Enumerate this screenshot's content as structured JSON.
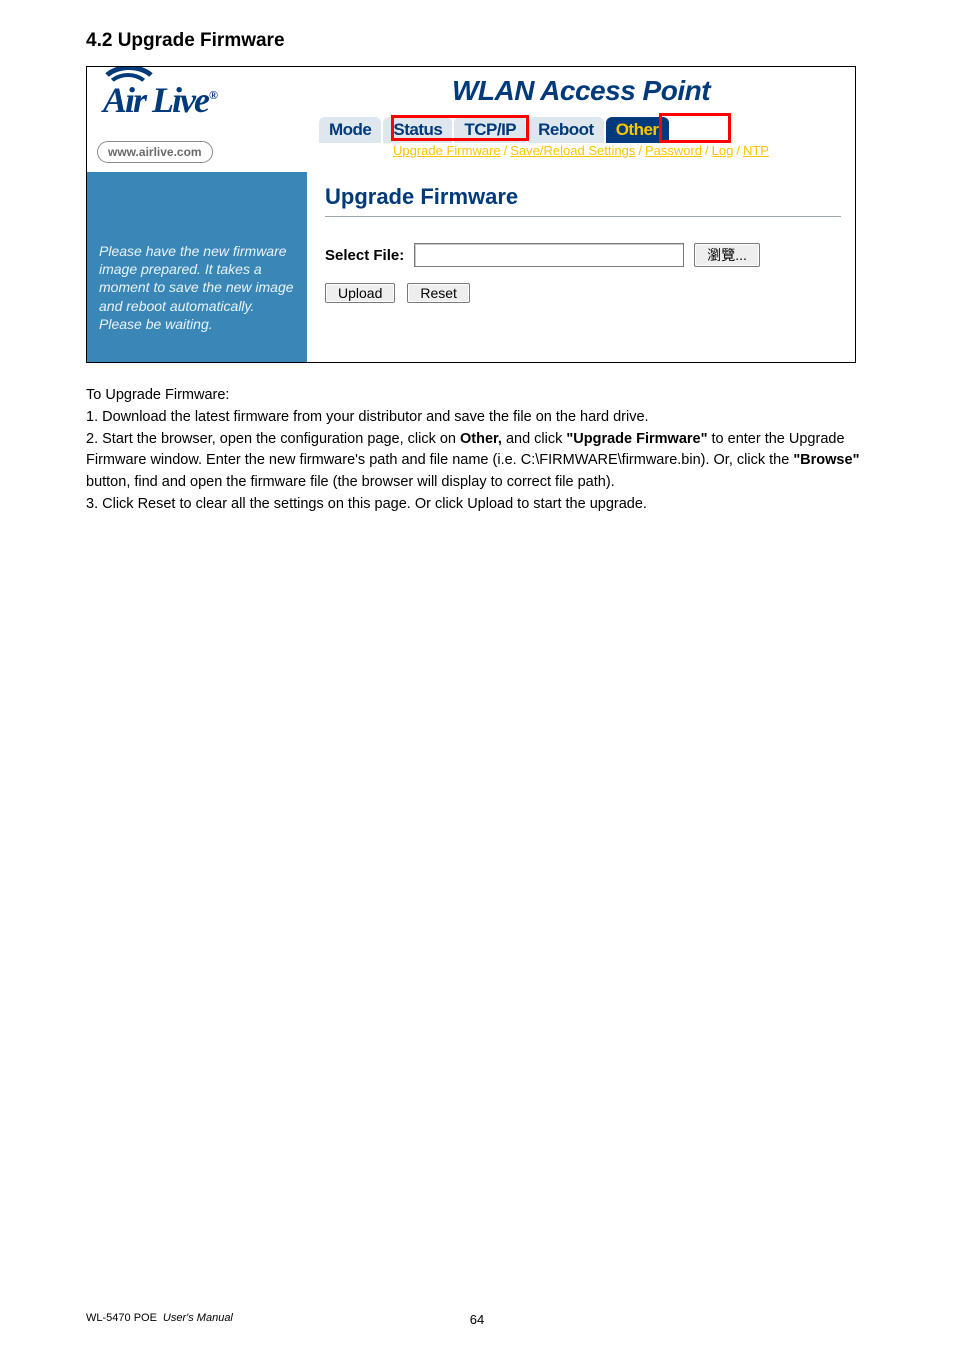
{
  "section_heading": "4.2 Upgrade Firmware",
  "logo": {
    "text": "Air Live",
    "reg": "®",
    "url": "www.airlive.com"
  },
  "wlan_title": "WLAN Access Point",
  "tabs": {
    "mode": "Mode",
    "status": "Status",
    "tcpip": "TCP/IP",
    "reboot": "Reboot",
    "other": "Other"
  },
  "sub_links": {
    "upgrade": "Upgrade Firmware",
    "save": "Save/Reload Settings",
    "password": "Password",
    "log": "Log",
    "ntp": "NTP"
  },
  "left_rail_text": "Please have the new firmware image prepared. It takes a moment to save the new image and reboot automatically. Please be waiting.",
  "panel_title": "Upgrade Firmware",
  "form": {
    "select_label": "Select File:",
    "browse_btn": "瀏覽...",
    "upload_btn": "Upload",
    "reset_btn": "Reset"
  },
  "body": {
    "intro": "To Upgrade Firmware:",
    "line1": "1. Download the latest firmware from your distributor and save the file on the hard drive.",
    "line2a": "2. Start the browser, open the configuration page, click on ",
    "line2b_bold": "Other,",
    "line2c": " and click ",
    "line2d_bold": "\"Upgrade Firmware\"",
    "line2e": " to enter the Upgrade Firmware window. Enter the new firmware's path and file name (i.e. C:\\FIRMWARE\\firmware.bin). Or, click the ",
    "line2f_bold": "\"Browse\"",
    "line2g": " button, find and open the firmware file (the browser will display to correct file path).",
    "line3": "3. Click Reset to clear all the settings on this page. Or click Upload to start the upgrade."
  },
  "footer": {
    "model": "WL-5470 POE",
    "manual": "User's Manual",
    "page": "64"
  }
}
